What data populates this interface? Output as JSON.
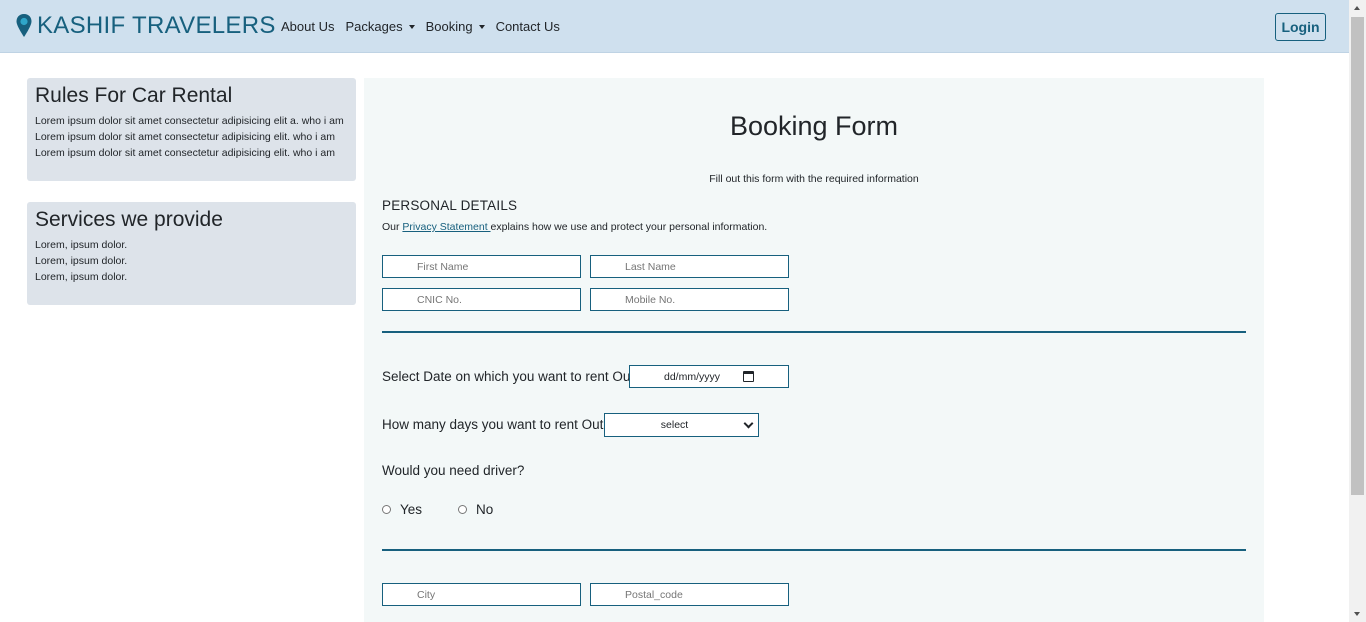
{
  "navbar": {
    "brand": "KASHIF TRAVELERS",
    "brand_icon": "map-pin-icon",
    "links": [
      {
        "label": "About Us",
        "dropdown": false
      },
      {
        "label": "Packages",
        "dropdown": true
      },
      {
        "label": "Booking",
        "dropdown": true
      },
      {
        "label": "Contact Us",
        "dropdown": false
      }
    ],
    "login_label": "Login"
  },
  "sidebar": {
    "rules": {
      "title": "Rules For Car Rental",
      "lines": [
        "Lorem ipsum dolor sit amet consectetur adipisicing elit a. who i am",
        "Lorem ipsum dolor sit amet consectetur adipisicing elit. who i am",
        "Lorem ipsum dolor sit amet consectetur adipisicing elit. who i am"
      ]
    },
    "services": {
      "title": "Services we provide",
      "lines": [
        "Lorem, ipsum dolor.",
        "Lorem, ipsum dolor.",
        "Lorem, ipsum dolor."
      ]
    }
  },
  "form": {
    "title": "Booking Form",
    "subtitle": "Fill out this form with the required information",
    "section_personal": "PERSONAL DETAILS",
    "privacy_prefix": "Our ",
    "privacy_link": "Privacy Statement ",
    "privacy_suffix": "explains how we use and protect your personal information.",
    "first_name_placeholder": "First Name",
    "last_name_placeholder": "Last Name",
    "cnic_placeholder": "CNIC No.",
    "mobile_placeholder": "Mobile No.",
    "date_question": "Select Date on which you want to rent Out?",
    "date_value": "dd/mm/yyyy",
    "days_question": "How many days you want to rent Out?",
    "days_selected": "select",
    "driver_question": "Would you need driver?",
    "driver_options": [
      "Yes",
      "No"
    ],
    "city_placeholder": "City",
    "postal_placeholder": "Postal_code"
  },
  "colors": {
    "navbar_bg": "#cfe0ee",
    "brand": "#17607e",
    "card_bg": "#dde3ea",
    "panel_bg": "#f3f8f8",
    "accent_line": "#17607e"
  }
}
